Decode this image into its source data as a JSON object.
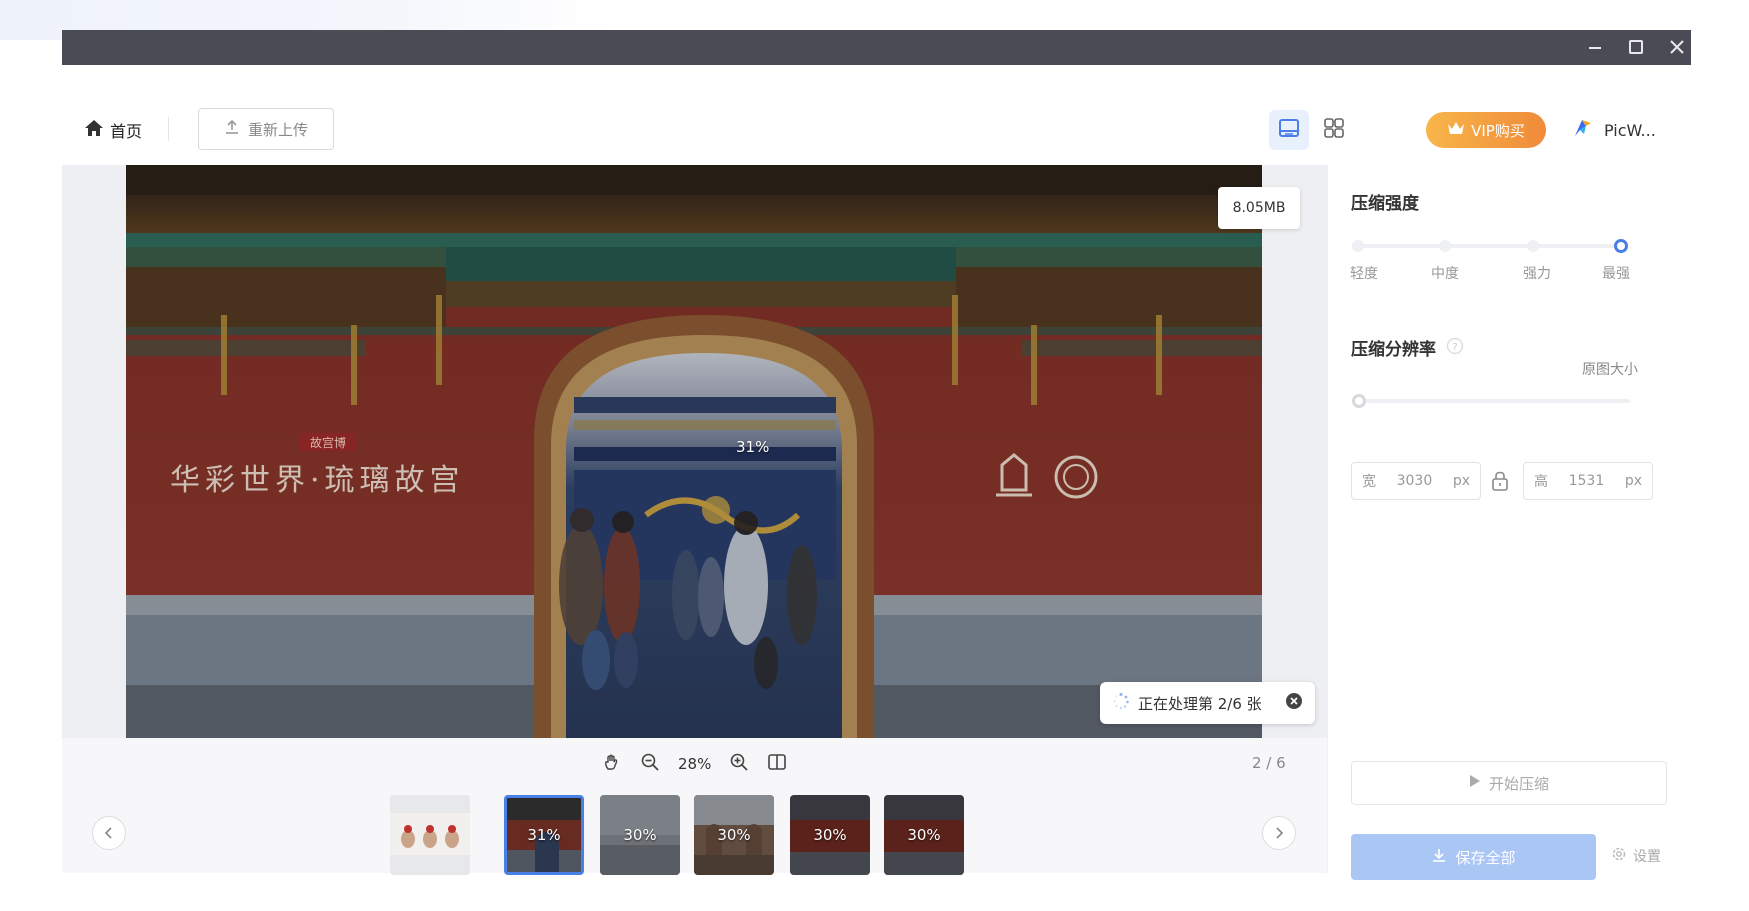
{
  "window": {
    "minimize_icon": "minimize-icon",
    "maximize_icon": "maximize-icon",
    "close_icon": "close-icon"
  },
  "toolbar": {
    "home_label": "首页",
    "reupload_label": "重新上传",
    "vip_label": "VIP购买",
    "brand_label": "PicW..."
  },
  "preview": {
    "file_size": "8.05MB",
    "overlay_percent": "31%",
    "banner_text": "华彩世界·琉璃故宫",
    "banner_seal": "故宫博",
    "processing_text": "正在处理第 2/6 张"
  },
  "viewer": {
    "zoom_value": "28%",
    "page_indicator": "2 / 6"
  },
  "thumbnails": [
    {
      "label": "",
      "selected": false
    },
    {
      "label": "31%",
      "selected": true
    },
    {
      "label": "30%",
      "selected": false
    },
    {
      "label": "30%",
      "selected": false
    },
    {
      "label": "30%",
      "selected": false
    },
    {
      "label": "30%",
      "selected": false
    }
  ],
  "panel": {
    "strength_title": "压缩强度",
    "strength_levels": [
      "轻度",
      "中度",
      "强力",
      "最强"
    ],
    "strength_selected": "最强",
    "resolution_title": "压缩分辨率",
    "resolution_mode": "原图大小",
    "width_label": "宽",
    "width_value": "3030",
    "height_label": "高",
    "height_value": "1531",
    "unit": "px",
    "start_label": "开始压缩",
    "save_all_label": "保存全部",
    "settings_label": "设置"
  },
  "colors": {
    "titlebar": "#4a4b55",
    "accent": "#4a7fe8",
    "vip_gradient_start": "#f8b649",
    "vip_gradient_end": "#f08a3a",
    "save_disabled": "#a9c6f5"
  }
}
